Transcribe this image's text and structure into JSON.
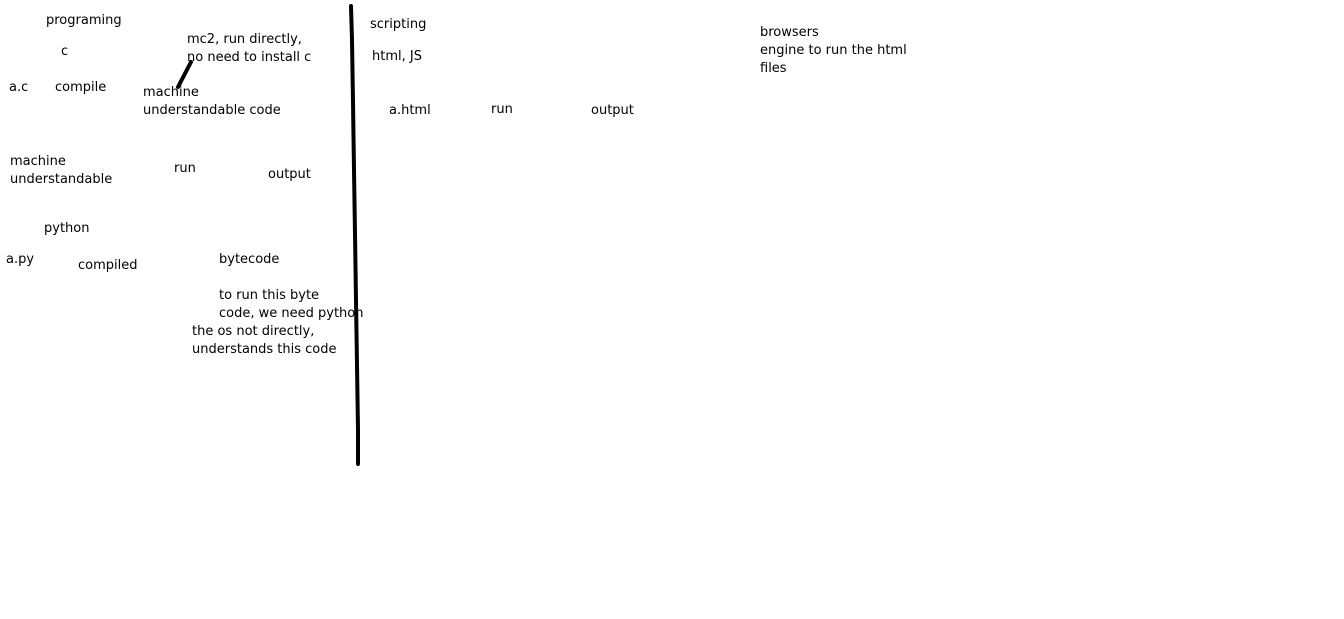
{
  "left_notes": {
    "programing": "programing",
    "c": "c",
    "mc2_line1": "mc2, run directly,",
    "mc2_line2": "no need to install c",
    "a_c": "a.c",
    "compile": "compile",
    "machine_code_line1": "machine",
    "machine_code_line2": "understandable code",
    "machine_line1": "machine",
    "machine_line2": "understandable",
    "run": "run",
    "output": "output",
    "python": "python",
    "a_py": "a.py",
    "compiled": "compiled",
    "bytecode": "bytecode",
    "byte_note_line1": "to run this byte",
    "byte_note_line2": "code, we need python",
    "os_note_line1": "the os not directly,",
    "os_note_line2": "understands this code"
  },
  "right_notes": {
    "scripting": "scripting",
    "html_js": "html, JS",
    "a_html": "a.html",
    "run": "run",
    "output": "output",
    "browsers_line1": "browsers",
    "browsers_line2": "engine to run the html",
    "browsers_line3": "files"
  },
  "ink_color": "#000000"
}
